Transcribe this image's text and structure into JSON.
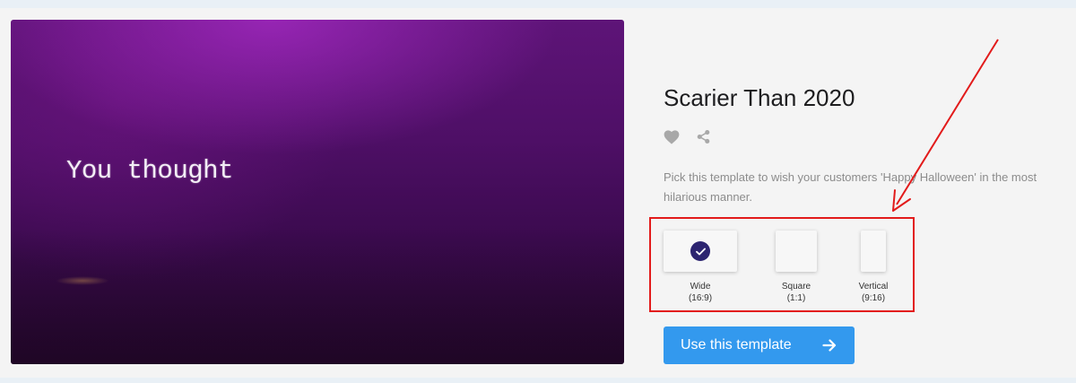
{
  "template": {
    "title": "Scarier Than 2020",
    "description": "Pick this template to wish your customers 'Happy Halloween' in the most hilarious manner.",
    "preview_text": "You thought",
    "icons": [
      "heart-icon",
      "share-icon"
    ]
  },
  "formats": [
    {
      "name": "Wide",
      "ratio": "(16:9)",
      "selected": true
    },
    {
      "name": "Square",
      "ratio": "(1:1)",
      "selected": false
    },
    {
      "name": "Vertical",
      "ratio": "(9:16)",
      "selected": false
    }
  ],
  "cta": {
    "label": "Use this template"
  },
  "colors": {
    "accent": "#3399ee",
    "check": "#2c2470",
    "annotation": "#e21b1b",
    "title": "#1d1d1f",
    "muted": "#8c8c8c"
  }
}
